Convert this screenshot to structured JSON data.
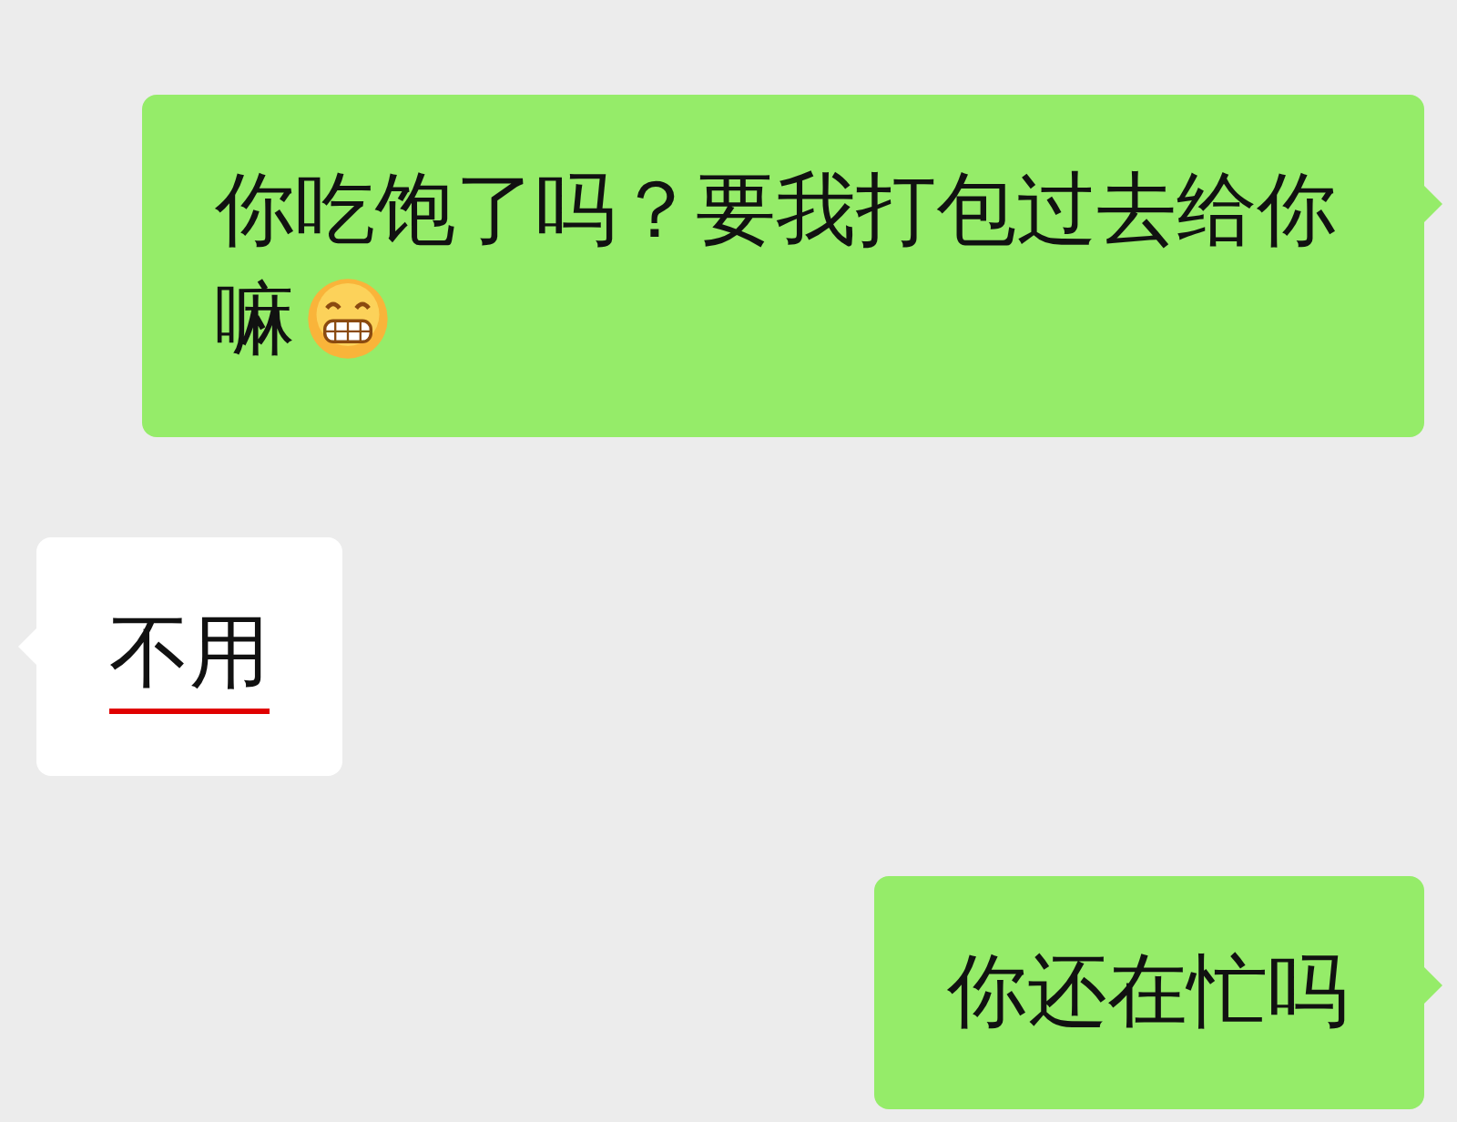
{
  "messages": [
    {
      "kind": "sent",
      "text": "你吃饱了吗？要我打包过去给你嘛",
      "emoji": true,
      "underlined": false
    },
    {
      "kind": "received",
      "text": "不用",
      "emoji": false,
      "underlined": true
    },
    {
      "kind": "sent",
      "text": "你还在忙吗",
      "emoji": false,
      "underlined": false
    }
  ]
}
